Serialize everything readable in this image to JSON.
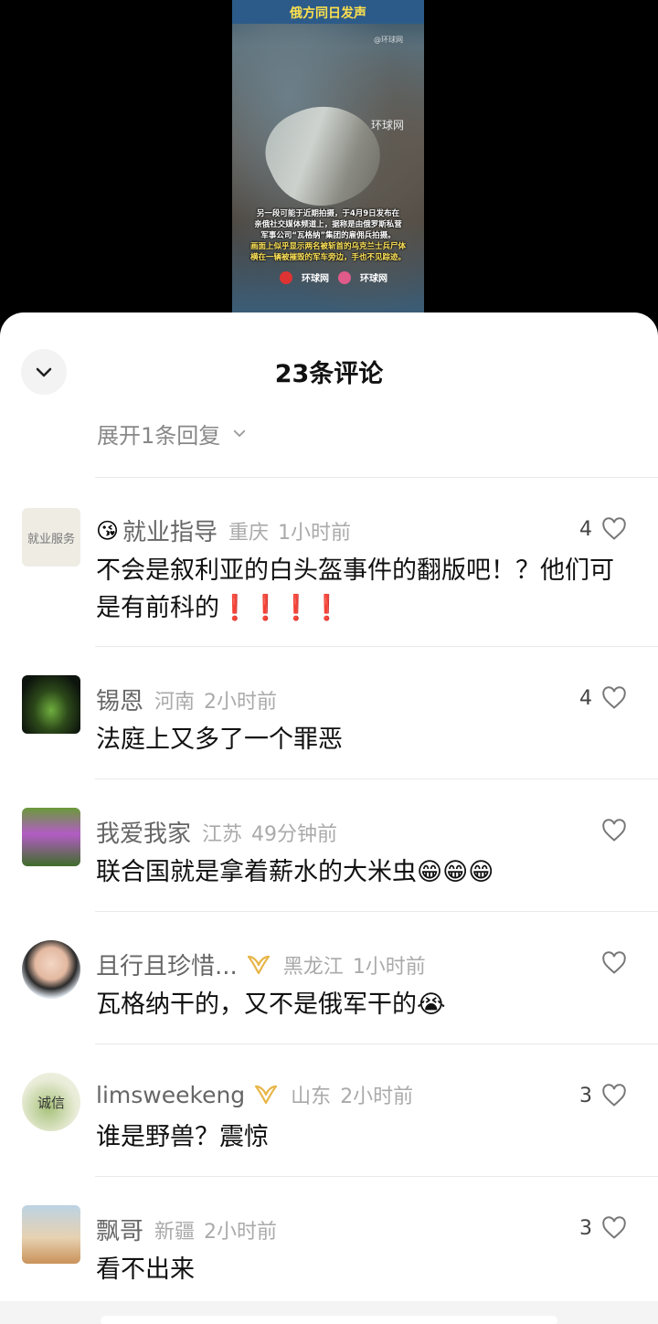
{
  "video": {
    "title": "俄方同日发声",
    "watermark_small": "@环球网",
    "watermark_logo": "环球网",
    "caption_lines": [
      "另一段可能于近期拍摄，于4月9日发布在",
      "亲俄社交媒体频道上，据称是由俄罗斯私营",
      "军事公司“瓦格纳”集团的雇佣兵拍摄。"
    ],
    "caption_highlight_lines": [
      "画面上似乎显示两名被斩首的乌克兰士兵尸体",
      "横在一辆被摧毁的军车旁边，手也不见踪迹。"
    ],
    "logo_1": "环球网",
    "logo_2": "环球网"
  },
  "sheet": {
    "title": "23条评论",
    "collapse_icon": "chevron-down-icon",
    "expand_replies": "展开1条回复"
  },
  "comments": [
    {
      "prefix_emoji": "😘",
      "username": "就业指导",
      "location": "重庆",
      "time": "1小时前",
      "text": "不会是叙利亚的白头盔事件的翻版吧！？他们可是有前科的❗❗❗❗",
      "likes": "4",
      "avatar_text": "就业服务"
    },
    {
      "username": "锡恩",
      "location": "河南",
      "time": "2小时前",
      "text": "法庭上又多了一个罪恶",
      "likes": "4"
    },
    {
      "username": "我爱我家",
      "location": "江苏",
      "time": "49分钟前",
      "text": "联合国就是拿着薪水的大米虫😁😁😁",
      "likes": ""
    },
    {
      "username": "且行且珍惜...",
      "location": "黑龙江",
      "time": "1小时前",
      "text": "瓦格纳干的，又不是俄军干的😭",
      "likes": ""
    },
    {
      "username": "limsweekeng",
      "location": "山东",
      "time": "2小时前",
      "text": "谁是野兽？震惊",
      "likes": "3",
      "avatar_text": "诚信"
    },
    {
      "username": "飘哥",
      "location": "新疆",
      "time": "2小时前",
      "text": "看不出来",
      "likes": "3"
    }
  ],
  "colors": {
    "badge_gold": "#e8b547",
    "video_title_bg": "#2c5b8a",
    "caption_highlight": "#ffe45a"
  }
}
